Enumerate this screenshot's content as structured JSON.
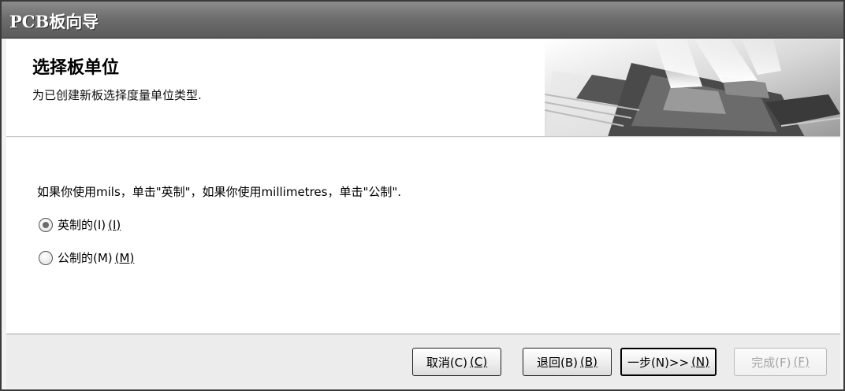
{
  "window": {
    "title": "PCB板向导"
  },
  "header": {
    "title": "选择板单位",
    "subtitle": "为已创建新板选择度量单位类型."
  },
  "content": {
    "instruction": "如果你使用mils，单击\"英制\"，如果你使用millimetres，单击\"公制\".",
    "options": [
      {
        "label": "英制的(I)",
        "hotkey": "(I)",
        "selected": true
      },
      {
        "label": "公制的(M)",
        "hotkey": "(M)",
        "selected": false
      }
    ]
  },
  "footer": {
    "cancel": {
      "label": "取消(C)",
      "hotkey": "(C)"
    },
    "back": {
      "label": "退回(B)",
      "hotkey": "(B)"
    },
    "next": {
      "label": "一步(N)>>",
      "hotkey": "(N)"
    },
    "finish": {
      "label": "完成(F)",
      "hotkey": "(F)"
    }
  }
}
